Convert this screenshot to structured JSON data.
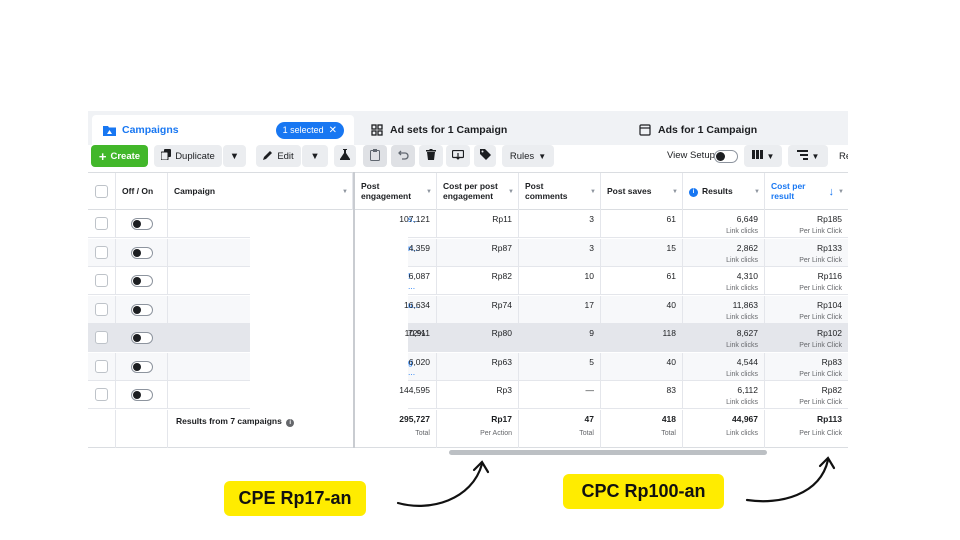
{
  "tabs": {
    "campaigns": {
      "label": "Campaigns",
      "selected": "1 selected"
    },
    "adsets": {
      "label": "Ad sets for 1 Campaign"
    },
    "ads": {
      "label": "Ads for 1 Campaign"
    }
  },
  "toolbar": {
    "create": "Create",
    "duplicate": "Duplicate",
    "edit": "Edit",
    "rules": "Rules",
    "view_setup": "View Setup",
    "reports_partial": "Re"
  },
  "table": {
    "headers": {
      "onoff": "Off / On",
      "campaign": "Campaign",
      "engagement": "Post engagement",
      "cpe": "Cost per post engagement",
      "comments": "Post comments",
      "saves": "Post saves",
      "results": "Results",
      "cpr": "Cost per result"
    },
    "rows": [
      {
        "frag": "s...",
        "engagement": "107,121",
        "cpe": "Rp11",
        "comments": "3",
        "saves": "61",
        "results": "6,649",
        "results_sub": "Link clicks",
        "cpr": "Rp185",
        "cpr_sub": "Per Link Click"
      },
      {
        "frag": "n...",
        "engagement": "4,359",
        "cpe": "Rp87",
        "comments": "3",
        "saves": "15",
        "results": "2,862",
        "results_sub": "Link clicks",
        "cpr": "Rp133",
        "cpr_sub": "Per Link Click"
      },
      {
        "frag": "! ...",
        "engagement": "6,087",
        "cpe": "Rp82",
        "comments": "10",
        "saves": "61",
        "results": "4,310",
        "results_sub": "Link clicks",
        "cpr": "Rp116",
        "cpr_sub": "Per Link Click"
      },
      {
        "frag": "u...",
        "engagement": "16,634",
        "cpe": "Rp74",
        "comments": "17",
        "saves": "40",
        "results": "11,863",
        "results_sub": "Link clicks",
        "cpr": "Rp104",
        "cpr_sub": "Per Link Click"
      },
      {
        "frag": "72%",
        "engagement": "10,911",
        "cpe": "Rp80",
        "comments": "9",
        "saves": "118",
        "results": "8,627",
        "results_sub": "Link clicks",
        "cpr": "Rp102",
        "cpr_sub": "Per Link Click"
      },
      {
        "frag": "g ...",
        "engagement": "6,020",
        "cpe": "Rp63",
        "comments": "5",
        "saves": "40",
        "results": "4,544",
        "results_sub": "Link clicks",
        "cpr": "Rp83",
        "cpr_sub": "Per Link Click"
      },
      {
        "frag": "",
        "engagement": "144,595",
        "cpe": "Rp3",
        "comments": "—",
        "saves": "83",
        "results": "6,112",
        "results_sub": "Link clicks",
        "cpr": "Rp82",
        "cpr_sub": "Per Link Click"
      }
    ],
    "totals": {
      "label": "Results from 7 campaigns",
      "engagement": "295,727",
      "engagement_sub": "Total",
      "cpe": "Rp17",
      "cpe_sub": "Per Action",
      "comments": "47",
      "comments_sub": "Total",
      "saves": "418",
      "saves_sub": "Total",
      "results": "44,967",
      "results_sub": "Link clicks",
      "cpr": "Rp113",
      "cpr_sub": "Per Link Click"
    }
  },
  "callouts": {
    "cpe": "CPE Rp17-an",
    "cpc": "CPC Rp100-an"
  },
  "colors": {
    "brand_blue": "#1877f2",
    "create_green": "#42b72a",
    "callout_yellow": "#ffec00"
  }
}
